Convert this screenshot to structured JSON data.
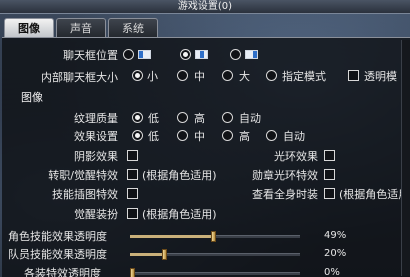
{
  "window": {
    "title": "游戏设置(0)"
  },
  "tabs": [
    {
      "label": "图像",
      "active": true
    },
    {
      "label": "声音",
      "active": false
    },
    {
      "label": "系统",
      "active": false
    }
  ],
  "chat": {
    "position_label": "聊天框位置",
    "position_icons": [
      "chat-left-icon",
      "chat-center-icon",
      "chat-right-icon"
    ],
    "position_selected": 1,
    "size_label": "内部聊天框大小",
    "size_options": [
      "小",
      "中",
      "大",
      "指定模式"
    ],
    "size_selected": 0,
    "transparent_label": "透明模"
  },
  "graphics": {
    "section_title": "图像",
    "texture_label": "纹理质量",
    "texture_options": [
      "低",
      "高",
      "自动"
    ],
    "texture_selected": 0,
    "effect_label": "效果设置",
    "effect_options": [
      "低",
      "中",
      "高",
      "自动"
    ],
    "effect_selected": 0,
    "shadow_label": "阴影效果",
    "halo_label": "光环效果",
    "job_label": "转职/觉醒特效",
    "by_character": "(根据角色适用)",
    "medal_label": "勋章光环特效",
    "skill_icon_label": "技能插图特效",
    "full_costume_label": "查看全身时装",
    "awaken_outfit_label": "觉醒装扮"
  },
  "sliders": [
    {
      "label": "角色技能效果透明度",
      "percent": 49,
      "text": "49%"
    },
    {
      "label": "队员技能效果透明度",
      "percent": 20,
      "text": "20%"
    },
    {
      "label": "各装特效透明度",
      "percent": 0,
      "text": "0%"
    }
  ],
  "colors": {
    "tab_active": "#e8e8e8",
    "slider_fill": "#c9b07a",
    "thumb": "#e0c070"
  }
}
